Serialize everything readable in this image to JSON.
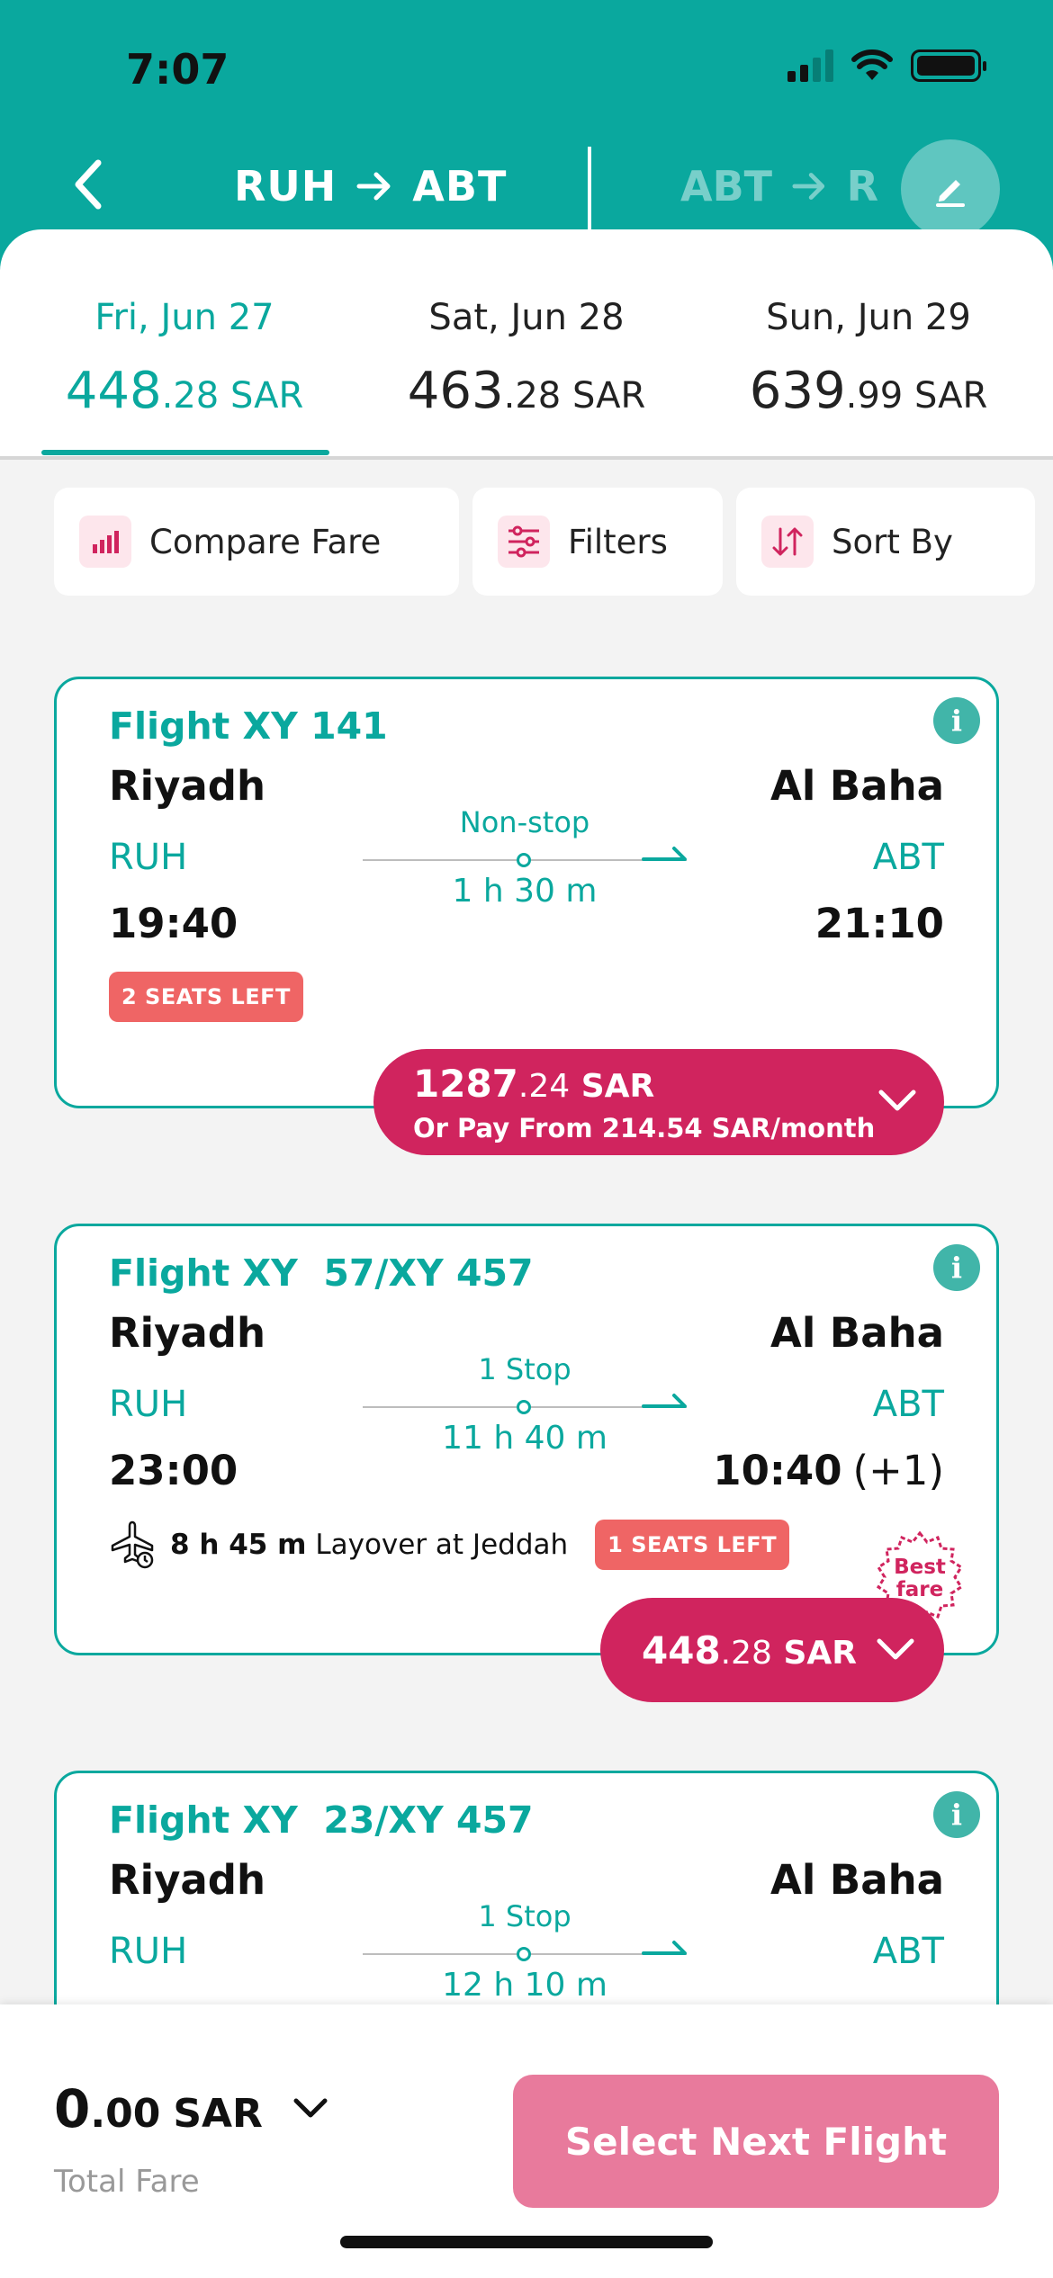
{
  "status_bar": {
    "time": "7:07"
  },
  "header": {
    "route": {
      "from": "RUH",
      "to": "ABT"
    },
    "next_route": {
      "from": "ABT",
      "to": "R"
    }
  },
  "date_tabs": [
    {
      "day": "Fri, Jun 27",
      "price_int": "448",
      "price_dec": ".28",
      "currency": "SAR",
      "active": true
    },
    {
      "day": "Sat, Jun 28",
      "price_int": "463",
      "price_dec": ".28",
      "currency": "SAR",
      "active": false
    },
    {
      "day": "Sun, Jun 29",
      "price_int": "639",
      "price_dec": ".99",
      "currency": "SAR",
      "active": false
    }
  ],
  "toolbar": {
    "compare": "Compare Fare",
    "filters": "Filters",
    "sort": "Sort By"
  },
  "flights": [
    {
      "number": "Flight XY 141",
      "from_city": "Riyadh",
      "to_city": "Al Baha",
      "from_code": "RUH",
      "to_code": "ABT",
      "stops": "Non-stop",
      "duration": "1 h 30 m",
      "depart": "19:40",
      "arrive": "21:10",
      "seats": "2 SEATS LEFT",
      "price_int": "1287",
      "price_dec": ".24",
      "currency": "SAR",
      "installment": "Or Pay From 214.54 SAR/month"
    },
    {
      "number": "Flight XY  57/XY 457",
      "from_city": "Riyadh",
      "to_city": "Al Baha",
      "from_code": "RUH",
      "to_code": "ABT",
      "stops": "1 Stop",
      "duration": "11 h 40 m",
      "depart": "23:00",
      "arrive": "10:40",
      "arrive_offset": "(+1)",
      "layover_duration": "8 h 45 m",
      "layover_text": "Layover at Jeddah",
      "seats": "1 SEATS LEFT",
      "badge": "Best fare",
      "price_int": "448",
      "price_dec": ".28",
      "currency": "SAR"
    },
    {
      "number": "Flight XY  23/XY 457",
      "from_city": "Riyadh",
      "to_city": "Al Baha",
      "from_code": "RUH",
      "to_code": "ABT",
      "stops": "1 Stop",
      "duration": "12 h 10 m"
    }
  ],
  "footer": {
    "total_int": "0",
    "total_dec": ".00",
    "currency": "SAR",
    "total_label": "Total Fare",
    "next_button": "Select Next Flight"
  },
  "colors": {
    "teal": "#0aa89e",
    "magenta": "#d0245e",
    "seat_red": "#ef6565",
    "next_button": "#e87a9c"
  }
}
